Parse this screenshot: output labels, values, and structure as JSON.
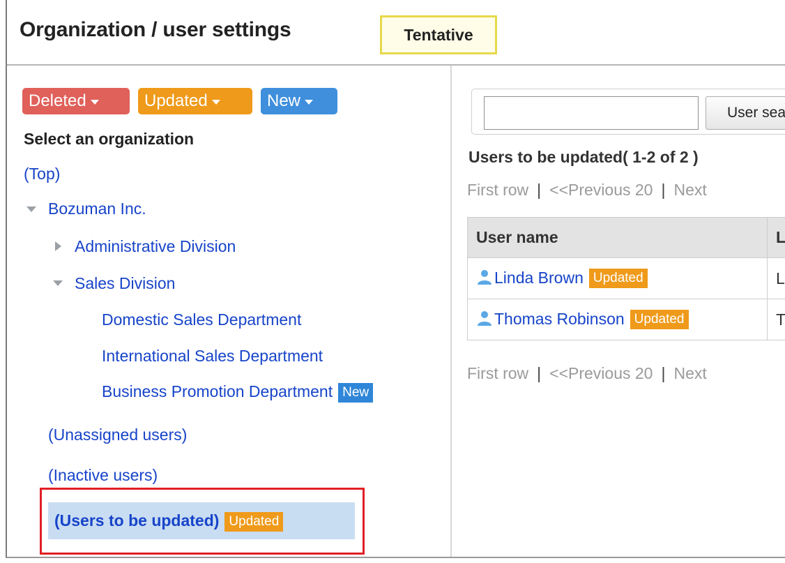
{
  "header": {
    "title": "Organization / user settings",
    "status_badge": "Tentative"
  },
  "filters": {
    "deleted_label": "Deleted",
    "updated_label": "Updated",
    "new_label": "New"
  },
  "org_tree": {
    "heading": "Select an organization",
    "top": "(Top)",
    "root": "Bozuman Inc.",
    "admin_division": "Administrative Division",
    "sales_division": "Sales Division",
    "domestic_sales": "Domestic Sales Department",
    "international_sales": "International Sales Department",
    "business_promotion": "Business Promotion Department",
    "business_promotion_badge": "New",
    "unassigned": "(Unassigned users)",
    "inactive": "(Inactive users)",
    "to_be_updated": "(Users to be updated)",
    "to_be_updated_badge": "Updated"
  },
  "search": {
    "value": "",
    "button_label": "User search"
  },
  "results": {
    "heading": "Users to be updated( 1-2 of 2 )",
    "pager": {
      "first": "First row",
      "previous": "<<Previous 20",
      "next": "Next"
    },
    "columns": [
      "User name",
      "L"
    ],
    "rows": [
      {
        "name": "Linda Brown",
        "badge": "Updated",
        "col2": "L"
      },
      {
        "name": "Thomas Robinson",
        "badge": "Updated",
        "col2": "T"
      }
    ]
  },
  "colors": {
    "deleted": "#e0605a",
    "updated": "#ef9a1a",
    "new": "#3f8fdc",
    "link": "#1744c9",
    "highlight": "#e01f26"
  }
}
